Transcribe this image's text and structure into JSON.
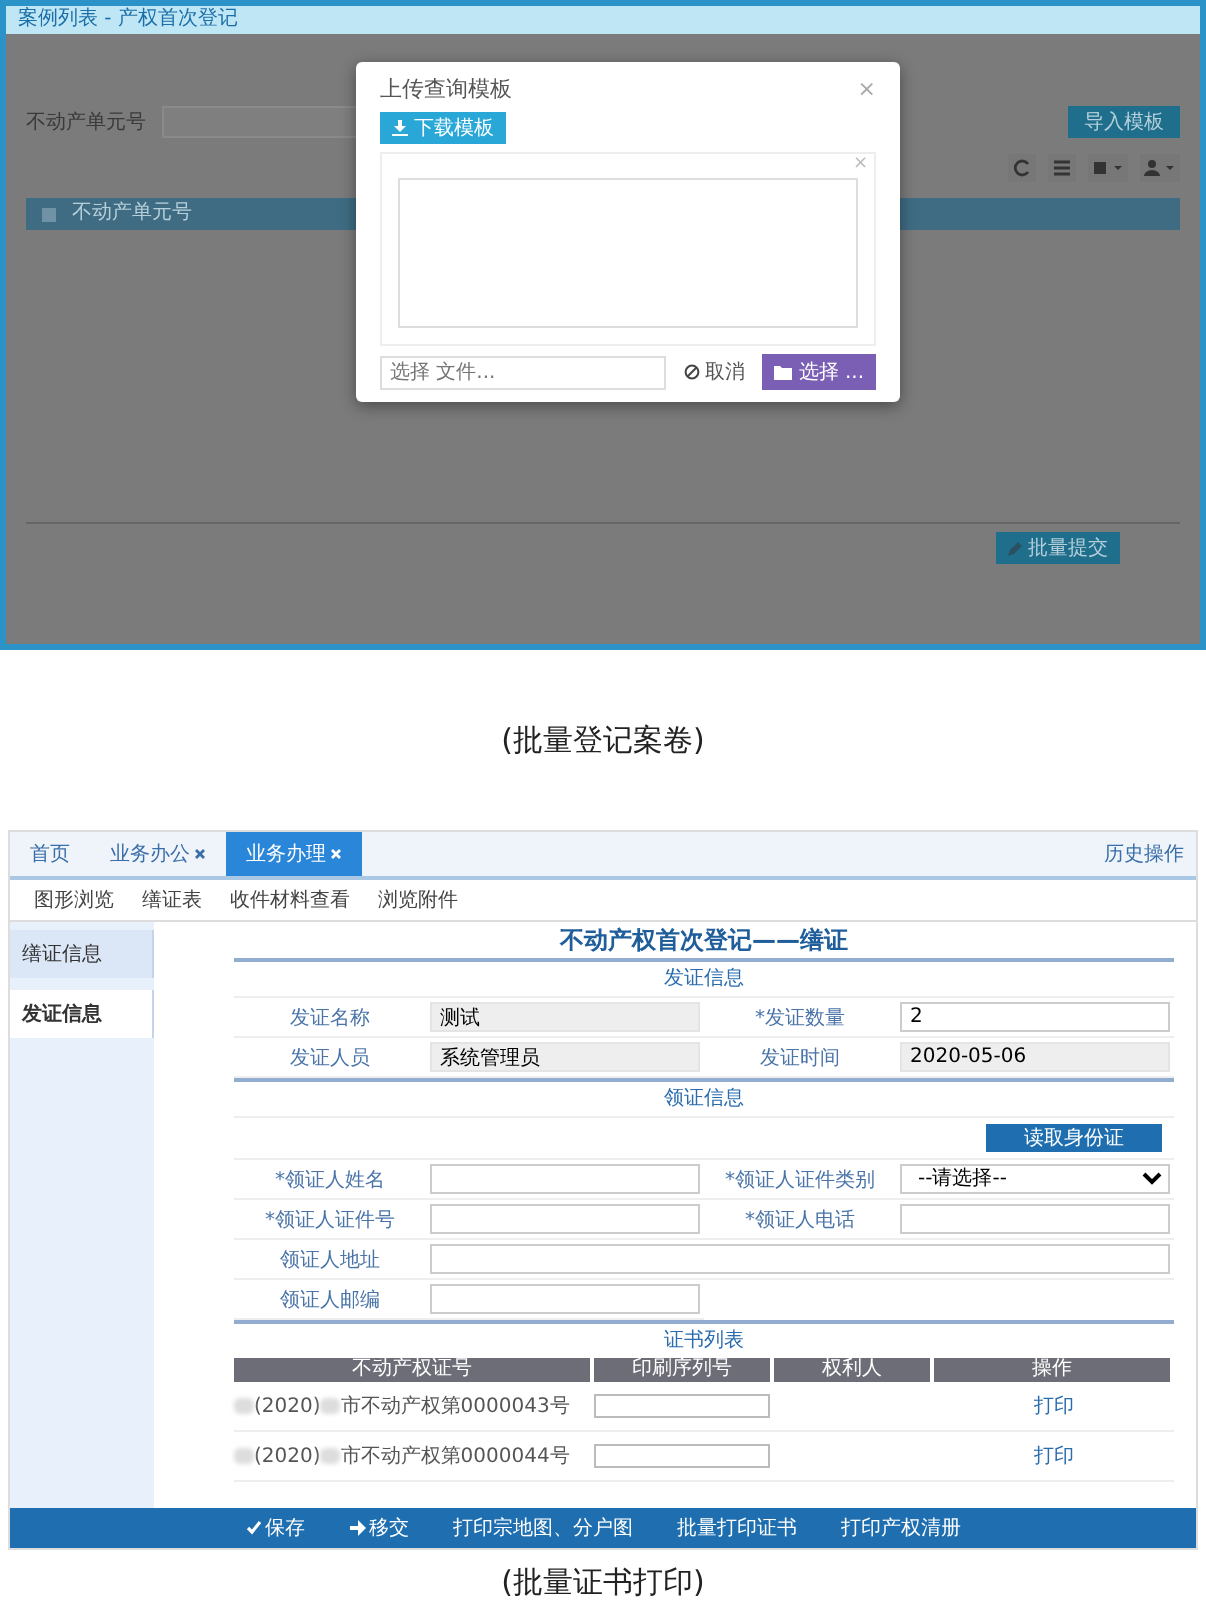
{
  "upload_screen": {
    "window_title": "案例列表 - 产权首次登记",
    "search_label": "不动产单元号",
    "import_button": "导入模板",
    "table_header": "不动产单元号",
    "submit_button": "批量提交",
    "modal": {
      "title": "上传查询模板",
      "close": "×",
      "download_button": "下载模板",
      "drop_close": "×",
      "file_field": {
        "placeholder": "选择 文件..."
      },
      "cancel_button": "取消",
      "browse_button": "选择 ..."
    }
  },
  "caption_top": "(批量登记案卷)",
  "certificate_screen": {
    "tabs": [
      {
        "label": "首页",
        "selected": false,
        "closable": false
      },
      {
        "label": "业务办公",
        "selected": false,
        "closable": true
      },
      {
        "label": "业务办理",
        "selected": true,
        "closable": true
      }
    ],
    "history_link": "历史操作",
    "subtabs": [
      "图形浏览",
      "缮证表",
      "收件材料查看",
      "浏览附件"
    ],
    "sidebar": [
      {
        "label": "缮证信息",
        "selected": false
      },
      {
        "label": "发证信息",
        "selected": true
      }
    ],
    "title": "不动产权首次登记——缮证",
    "issue_section": {
      "title": "发证信息",
      "fields": [
        {
          "label": "发证名称",
          "value": "测试",
          "readonly": true
        },
        {
          "label": "*发证数量",
          "value": "2",
          "readonly": false
        },
        {
          "label": "发证人员",
          "value": "系统管理员",
          "readonly": true
        },
        {
          "label": "发证时间",
          "value": "2020-05-06",
          "readonly": true
        }
      ]
    },
    "receive_section": {
      "title": "领证信息",
      "read_id_button": "读取身份证",
      "fields": [
        {
          "label": "*领证人姓名",
          "kind": "input"
        },
        {
          "label": "*领证人证件类别",
          "kind": "select",
          "value": "--请选择--"
        },
        {
          "label": "*领证人证件号",
          "kind": "input"
        },
        {
          "label": "*领证人电话",
          "kind": "input"
        },
        {
          "label": "领证人地址",
          "kind": "wide"
        },
        {
          "label": "领证人邮编",
          "kind": "input"
        }
      ]
    },
    "cert_section": {
      "title": "证书列表",
      "columns": [
        "不动产权证号",
        "印刷序列号",
        "权利人",
        "操作"
      ],
      "rows": [
        {
          "year": "(2020)",
          "number": "市不动产权第0000043号",
          "action": "打印"
        },
        {
          "year": "(2020)",
          "number": "市不动产权第0000044号",
          "action": "打印"
        }
      ]
    },
    "actions": [
      {
        "label": "保存",
        "kind": "check"
      },
      {
        "label": "移交",
        "kind": "arrow"
      },
      {
        "label": "打印宗地图、分户图",
        "kind": "plain"
      },
      {
        "label": "批量打印证书",
        "kind": "plain"
      },
      {
        "label": "打印产权清册",
        "kind": "plain"
      }
    ]
  },
  "caption_bottom": "(批量证书打印)"
}
